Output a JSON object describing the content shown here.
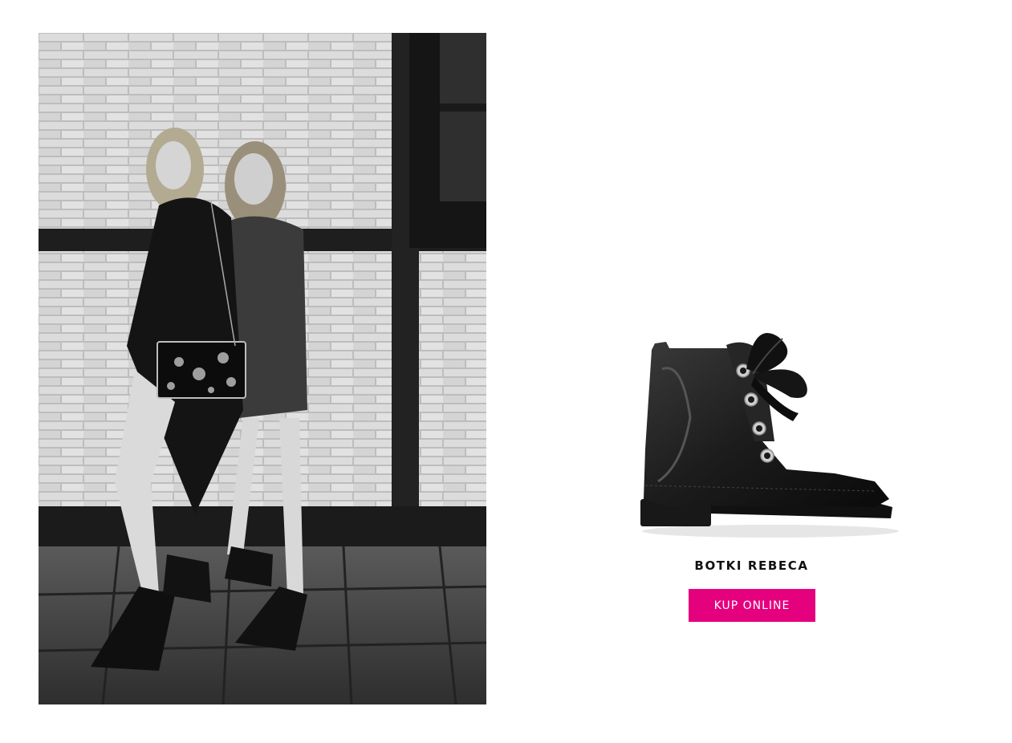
{
  "lifestyle_photo": {
    "description_icon": "lifestyle-photo-two-models-brick-wall"
  },
  "product": {
    "image_icon": "black-ankle-boot-with-ribbon-laces",
    "name": "BOTKI REBECA",
    "cta_label": "KUP ONLINE"
  },
  "colors": {
    "background": "#ffffff",
    "accent": "#e5007e",
    "button_text": "#ffffff",
    "product_name": "#111111"
  }
}
